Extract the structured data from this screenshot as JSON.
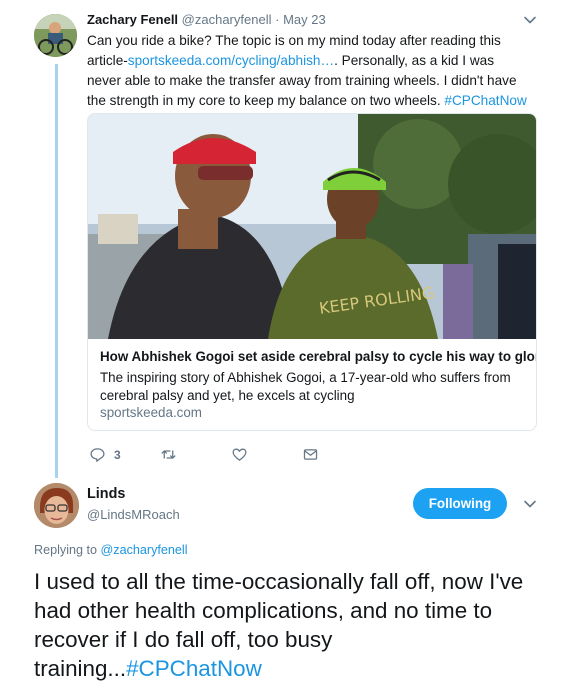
{
  "tweet1": {
    "author_name": "Zachary Fenell",
    "author_handle": "@zacharyfenell",
    "separator": "·",
    "date": "May 23",
    "text_1": "Can you ride a bike? The topic is on my mind today after reading this article-",
    "link_text": "sportskeeda.com/cycling/abhish…",
    "text_2": ". Personally, as a kid I was never able to make the transfer away from training wheels. I didn't have the strength in my core to keep my balance on two wheels.",
    "hashtag": "#CPChatNow",
    "card": {
      "title": "How Abhishek Gogoi set aside cerebral palsy to cycle his way to glory",
      "description": "The inspiring story of Abhishek Gogoi, a 17-year-old who suffers from cerebral palsy and yet, he excels at cycling",
      "domain": "sportskeeda.com",
      "shirt_text": "KEEP ROLLING"
    },
    "actions": {
      "reply_count": "3",
      "reply_icon": "reply-icon",
      "retweet_icon": "retweet-icon",
      "like_icon": "heart-icon",
      "dm_icon": "envelope-icon"
    }
  },
  "tweet2": {
    "author_name": "Linds",
    "author_handle": "@LindsMRoach",
    "follow_label": "Following",
    "replying_prefix": "Replying to ",
    "replying_handle": "@zacharyfenell",
    "text": "I used to all the time-occasionally fall off, now I've had other health complications, and no time to recover if I do fall off, too busy training...",
    "hashtag": "#CPChatNow"
  },
  "colors": {
    "accent": "#1da1f2",
    "link": "#1b95e0",
    "muted": "#657786",
    "thread_line": "#a8d3f0",
    "border": "#e1e8ed"
  }
}
